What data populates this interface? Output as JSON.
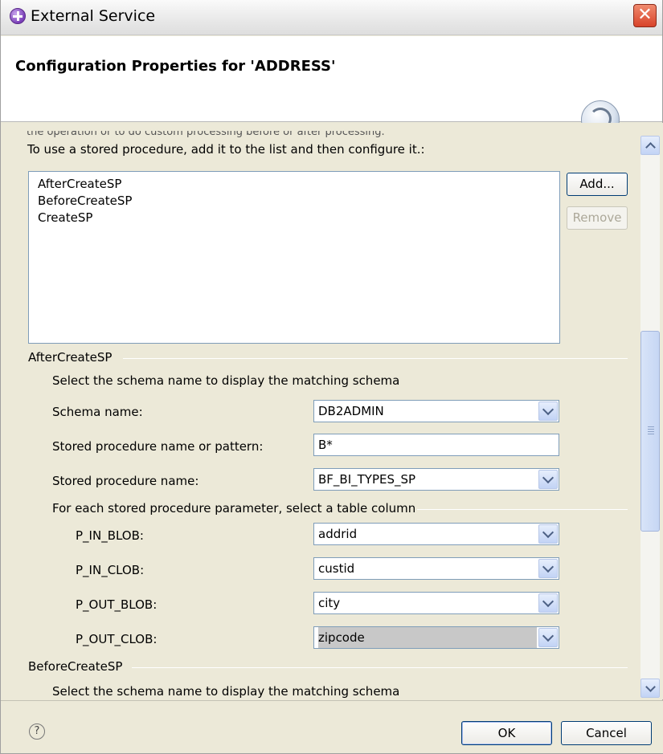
{
  "window": {
    "title": "External Service",
    "banner_title": "Configuration Properties for 'ADDRESS'"
  },
  "content": {
    "clipped_text": "the operation or to do custom processing before or after processing.",
    "instruction": "To use a stored procedure, add it to the list and then configure it.:",
    "stored_procedures": [
      "AfterCreateSP",
      "BeforeCreateSP",
      "CreateSP"
    ],
    "add_button": "Add...",
    "remove_button": "Remove"
  },
  "after_section": {
    "heading": "AfterCreateSP",
    "description": "Select the schema name to display the matching schema",
    "schema_label": "Schema name:",
    "schema_value": "DB2ADMIN",
    "pattern_label": "Stored procedure name or pattern:",
    "pattern_value": "B*",
    "sp_name_label": "Stored procedure name:",
    "sp_name_value": "BF_BI_TYPES_SP",
    "param_heading": "For each stored procedure parameter, select a table column",
    "params": [
      {
        "label": "P_IN_BLOB:",
        "value": "addrid"
      },
      {
        "label": "P_IN_CLOB:",
        "value": "custid"
      },
      {
        "label": "P_OUT_BLOB:",
        "value": "city"
      },
      {
        "label": "P_OUT_CLOB:",
        "value": "zipcode"
      }
    ]
  },
  "before_section": {
    "heading": "BeforeCreateSP",
    "description": "Select the schema name to display the matching schema"
  },
  "footer": {
    "help_symbol": "?",
    "ok_button": "OK",
    "cancel_button": "Cancel"
  },
  "colors": {
    "dialog_background": "#ece9d8",
    "field_border": "#7f9db9",
    "close_button": "#d8432a"
  }
}
